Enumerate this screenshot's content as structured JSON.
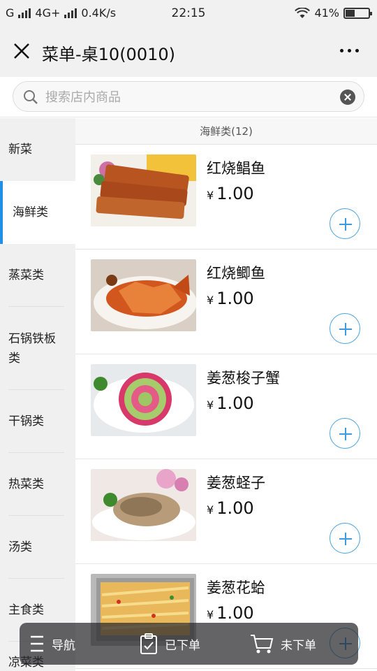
{
  "status_bar": {
    "network_left": "G",
    "network_mid": "4G+",
    "speed": "0.4K/s",
    "time": "22:15",
    "battery": "41%",
    "battery_level": 0.41,
    "icons": [
      "signal-icon",
      "signal-icon",
      "wifi-icon",
      "battery-icon"
    ]
  },
  "header": {
    "title": "菜单-桌10(0010)",
    "close_icon": "close-icon",
    "more_icon": "more-icon"
  },
  "search": {
    "placeholder": "搜索店内商品",
    "value": "",
    "icon": "search-icon",
    "clear_icon": "clear-icon"
  },
  "sidebar": {
    "items": [
      {
        "label": "新菜",
        "active": false
      },
      {
        "label": "海鲜类",
        "active": true
      },
      {
        "label": "蒸菜类",
        "active": false
      },
      {
        "label": "石锅铁板类",
        "active": false
      },
      {
        "label": "干锅类",
        "active": false
      },
      {
        "label": "热菜类",
        "active": false
      },
      {
        "label": "汤类",
        "active": false
      },
      {
        "label": "主食类",
        "active": false
      },
      {
        "label": "凉菜类",
        "active": false
      }
    ]
  },
  "main": {
    "section_title": "海鲜类(12)",
    "items": [
      {
        "name": "红烧鲳鱼",
        "currency": "¥",
        "price": "1.00"
      },
      {
        "name": "红烧鲫鱼",
        "currency": "¥",
        "price": "1.00"
      },
      {
        "name": "姜葱梭子蟹",
        "currency": "¥",
        "price": "1.00"
      },
      {
        "name": "姜葱蛏子",
        "currency": "¥",
        "price": "1.00"
      },
      {
        "name": "姜葱花蛤",
        "currency": "¥",
        "price": "1.00"
      }
    ]
  },
  "bottom_nav": {
    "nav_label": "导航",
    "ordered_label": "已下单",
    "not_ordered_label": "未下单"
  },
  "colors": {
    "accent": "#1e90e8",
    "add_button": "#3a9be0",
    "sidebar_bg": "#f0f0f0",
    "bar_bg": "#f1f1f1"
  }
}
